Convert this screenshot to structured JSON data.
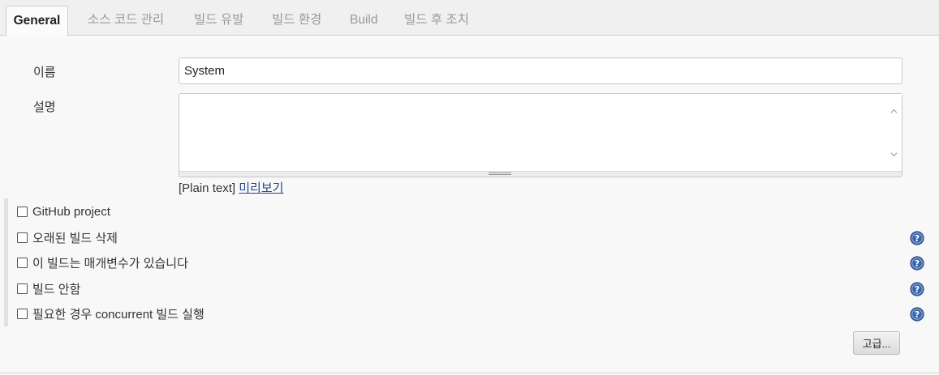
{
  "tabs": [
    {
      "label": "General",
      "active": true
    },
    {
      "label": "소스 코드 관리"
    },
    {
      "label": "빌드 유발"
    },
    {
      "label": "빌드 환경"
    },
    {
      "label": "Build"
    },
    {
      "label": "빌드 후 조치"
    }
  ],
  "form": {
    "name_label": "이름",
    "name_value": "System",
    "description_label": "설명",
    "description_value": "",
    "preview_prefix": "[Plain text]",
    "preview_link": "미리보기"
  },
  "options": [
    {
      "label": "GitHub project",
      "checked": false,
      "help": false
    },
    {
      "label": "오래된 빌드 삭제",
      "checked": false,
      "help": true
    },
    {
      "label": "이 빌드는 매개변수가 있습니다",
      "checked": false,
      "help": true
    },
    {
      "label": "빌드 안함",
      "checked": false,
      "help": true
    },
    {
      "label": "필요한 경우 concurrent 빌드 실행",
      "checked": false,
      "help": true
    }
  ],
  "advanced_button": "고급...",
  "colors": {
    "link": "#204a87",
    "help_icon": "#3b64a8"
  }
}
